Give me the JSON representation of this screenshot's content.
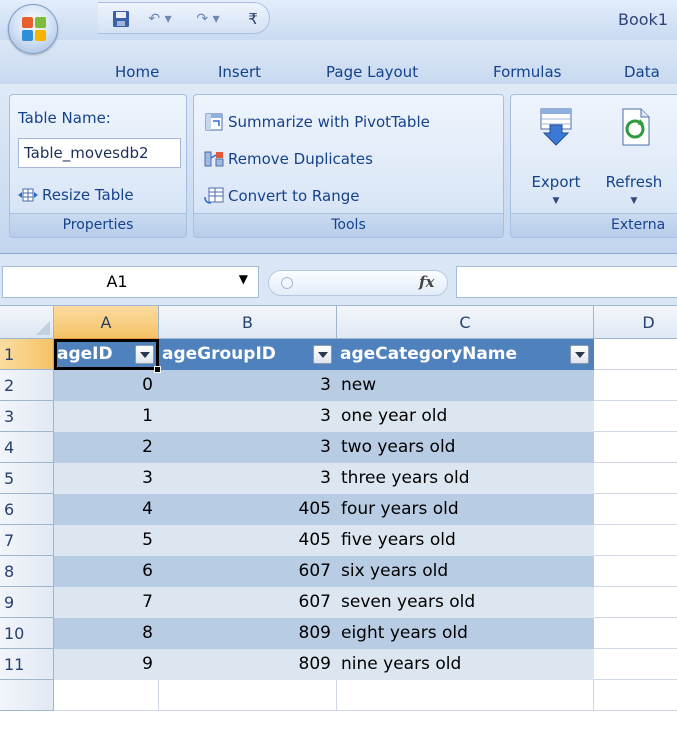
{
  "app": {
    "title": "Book1"
  },
  "colors": {
    "table_header": "#4f81bd",
    "band_dark": "#b8cce4",
    "band_light": "#dce6f1",
    "selected_header": "#f5c266"
  },
  "quick_access": {
    "items": [
      "save-icon",
      "undo-icon",
      "redo-icon",
      "customize-icon"
    ],
    "undo_label": "↶ ▾",
    "redo_label": "↷ ▾",
    "customize_label": "₹"
  },
  "tabs": [
    {
      "label": "Home"
    },
    {
      "label": "Insert"
    },
    {
      "label": "Page Layout"
    },
    {
      "label": "Formulas"
    },
    {
      "label": "Data"
    }
  ],
  "ribbon": {
    "properties": {
      "label": "Properties",
      "table_name_label": "Table Name:",
      "table_name_value": "Table_movesdb2",
      "resize_label": "Resize Table"
    },
    "tools": {
      "label": "Tools",
      "summarize_label": "Summarize with PivotTable",
      "remove_duplicates_label": "Remove Duplicates",
      "convert_label": "Convert to Range"
    },
    "external": {
      "label": "Externa",
      "export_label": "Export",
      "refresh_label": "Refresh",
      "arrow": "▼"
    }
  },
  "formula_bar": {
    "name_box": "A1",
    "name_box_arrow": "▼",
    "fx_label": "fx",
    "formula": ""
  },
  "grid": {
    "columns": [
      "A",
      "B",
      "C",
      "D"
    ],
    "selected_column": "A",
    "rows": [
      {
        "num": "1",
        "a": "ageID",
        "b": "ageGroupID",
        "c": "ageCategoryName"
      },
      {
        "num": "2",
        "a": "0",
        "b": "3",
        "c": "new"
      },
      {
        "num": "3",
        "a": "1",
        "b": "3",
        "c": "one year old"
      },
      {
        "num": "4",
        "a": "2",
        "b": "3",
        "c": "two years old"
      },
      {
        "num": "5",
        "a": "3",
        "b": "3",
        "c": "three years old"
      },
      {
        "num": "6",
        "a": "4",
        "b": "405",
        "c": "four years old"
      },
      {
        "num": "7",
        "a": "5",
        "b": "405",
        "c": "five years old"
      },
      {
        "num": "8",
        "a": "6",
        "b": "607",
        "c": "six years old"
      },
      {
        "num": "9",
        "a": "7",
        "b": "607",
        "c": "seven years old"
      },
      {
        "num": "10",
        "a": "8",
        "b": "809",
        "c": "eight years old"
      },
      {
        "num": "11",
        "a": "9",
        "b": "809",
        "c": "nine years old"
      }
    ]
  }
}
